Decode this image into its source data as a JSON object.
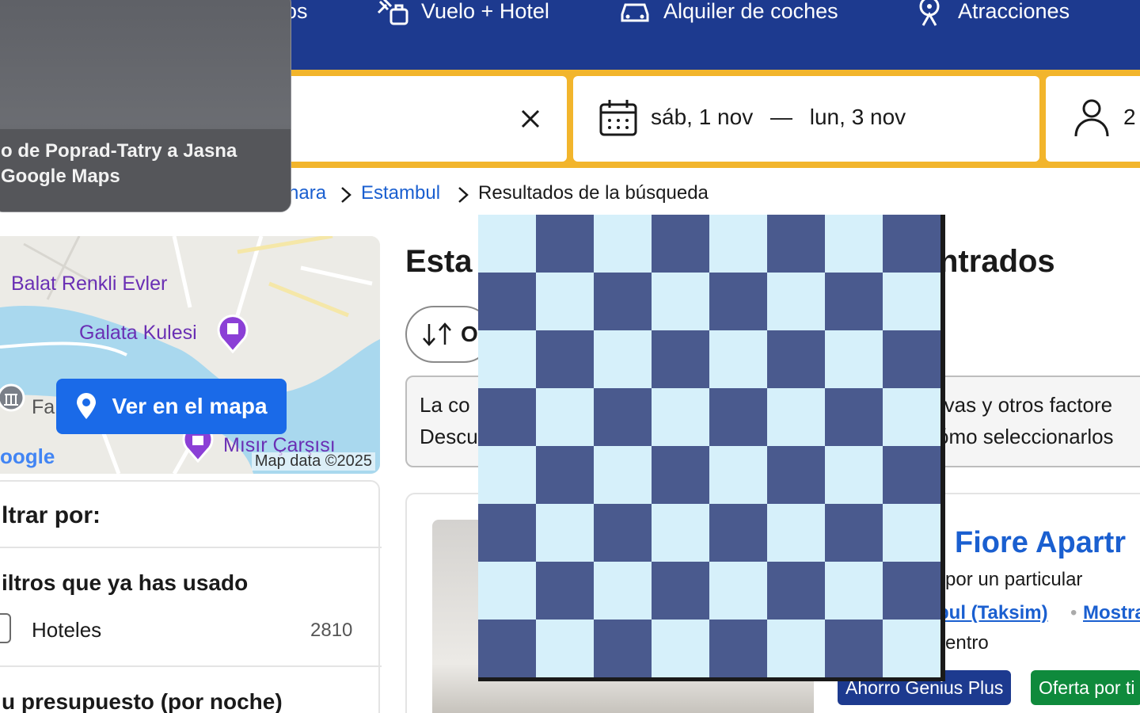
{
  "nav": {
    "items": [
      {
        "label": "os",
        "icon": "bed-icon"
      },
      {
        "label": "Vuelo + Hotel",
        "icon": "flight-hotel-icon"
      },
      {
        "label": "Alquiler de coches",
        "icon": "car-icon"
      },
      {
        "label": "Atracciones",
        "icon": "attractions-icon"
      }
    ]
  },
  "search": {
    "destination_value": "",
    "date_from": "sáb, 1 nov",
    "date_sep": "—",
    "date_to": "lun, 3 nov",
    "guests": "2"
  },
  "breadcrumb": {
    "items": [
      {
        "label": "nara",
        "link": true
      },
      {
        "label": "Estambul",
        "link": true
      },
      {
        "label": "Resultados de la búsqueda",
        "link": false
      }
    ]
  },
  "popup": {
    "line1": "o de Poprad-Tatry a Jasna",
    "line2": "Google Maps"
  },
  "map": {
    "labels": [
      "Balat Renkli Evler",
      "Galata Kulesi",
      "Fa",
      "Mısır Çarşısı"
    ],
    "button": "Ver en el mapa",
    "credit": "Map data ©2025",
    "google": "oogle"
  },
  "filters": {
    "title": "ltrar por:",
    "used_heading": "iltros que ya has usado",
    "option_label": "Hoteles",
    "option_count": "2810",
    "budget_heading": "u presupuesto (por noche)"
  },
  "results": {
    "title_start": "Esta",
    "title_end": "ntrados",
    "sort_label": "O",
    "notice_l1": "La co",
    "notice_l2": "Descu",
    "notice_r1": "rvas y otros factore",
    "notice_r2": "ómo seleccionarlos"
  },
  "hotel": {
    "name": "Fiore Apartr",
    "subtitle": "por un particular",
    "location": "bul (Taksim)",
    "dot": "•",
    "map_link": "Mostra",
    "distance": "entro",
    "badge_genius": "Ahorro Genius Plus",
    "badge_offer": "Oferta por ti"
  },
  "colors": {
    "brand_blue": "#1d3a8f",
    "accent_yellow": "#f2b52c",
    "link_blue": "#1a5fd0",
    "checker_dark": "#4a5a8e",
    "checker_light": "#d6f0fa"
  }
}
